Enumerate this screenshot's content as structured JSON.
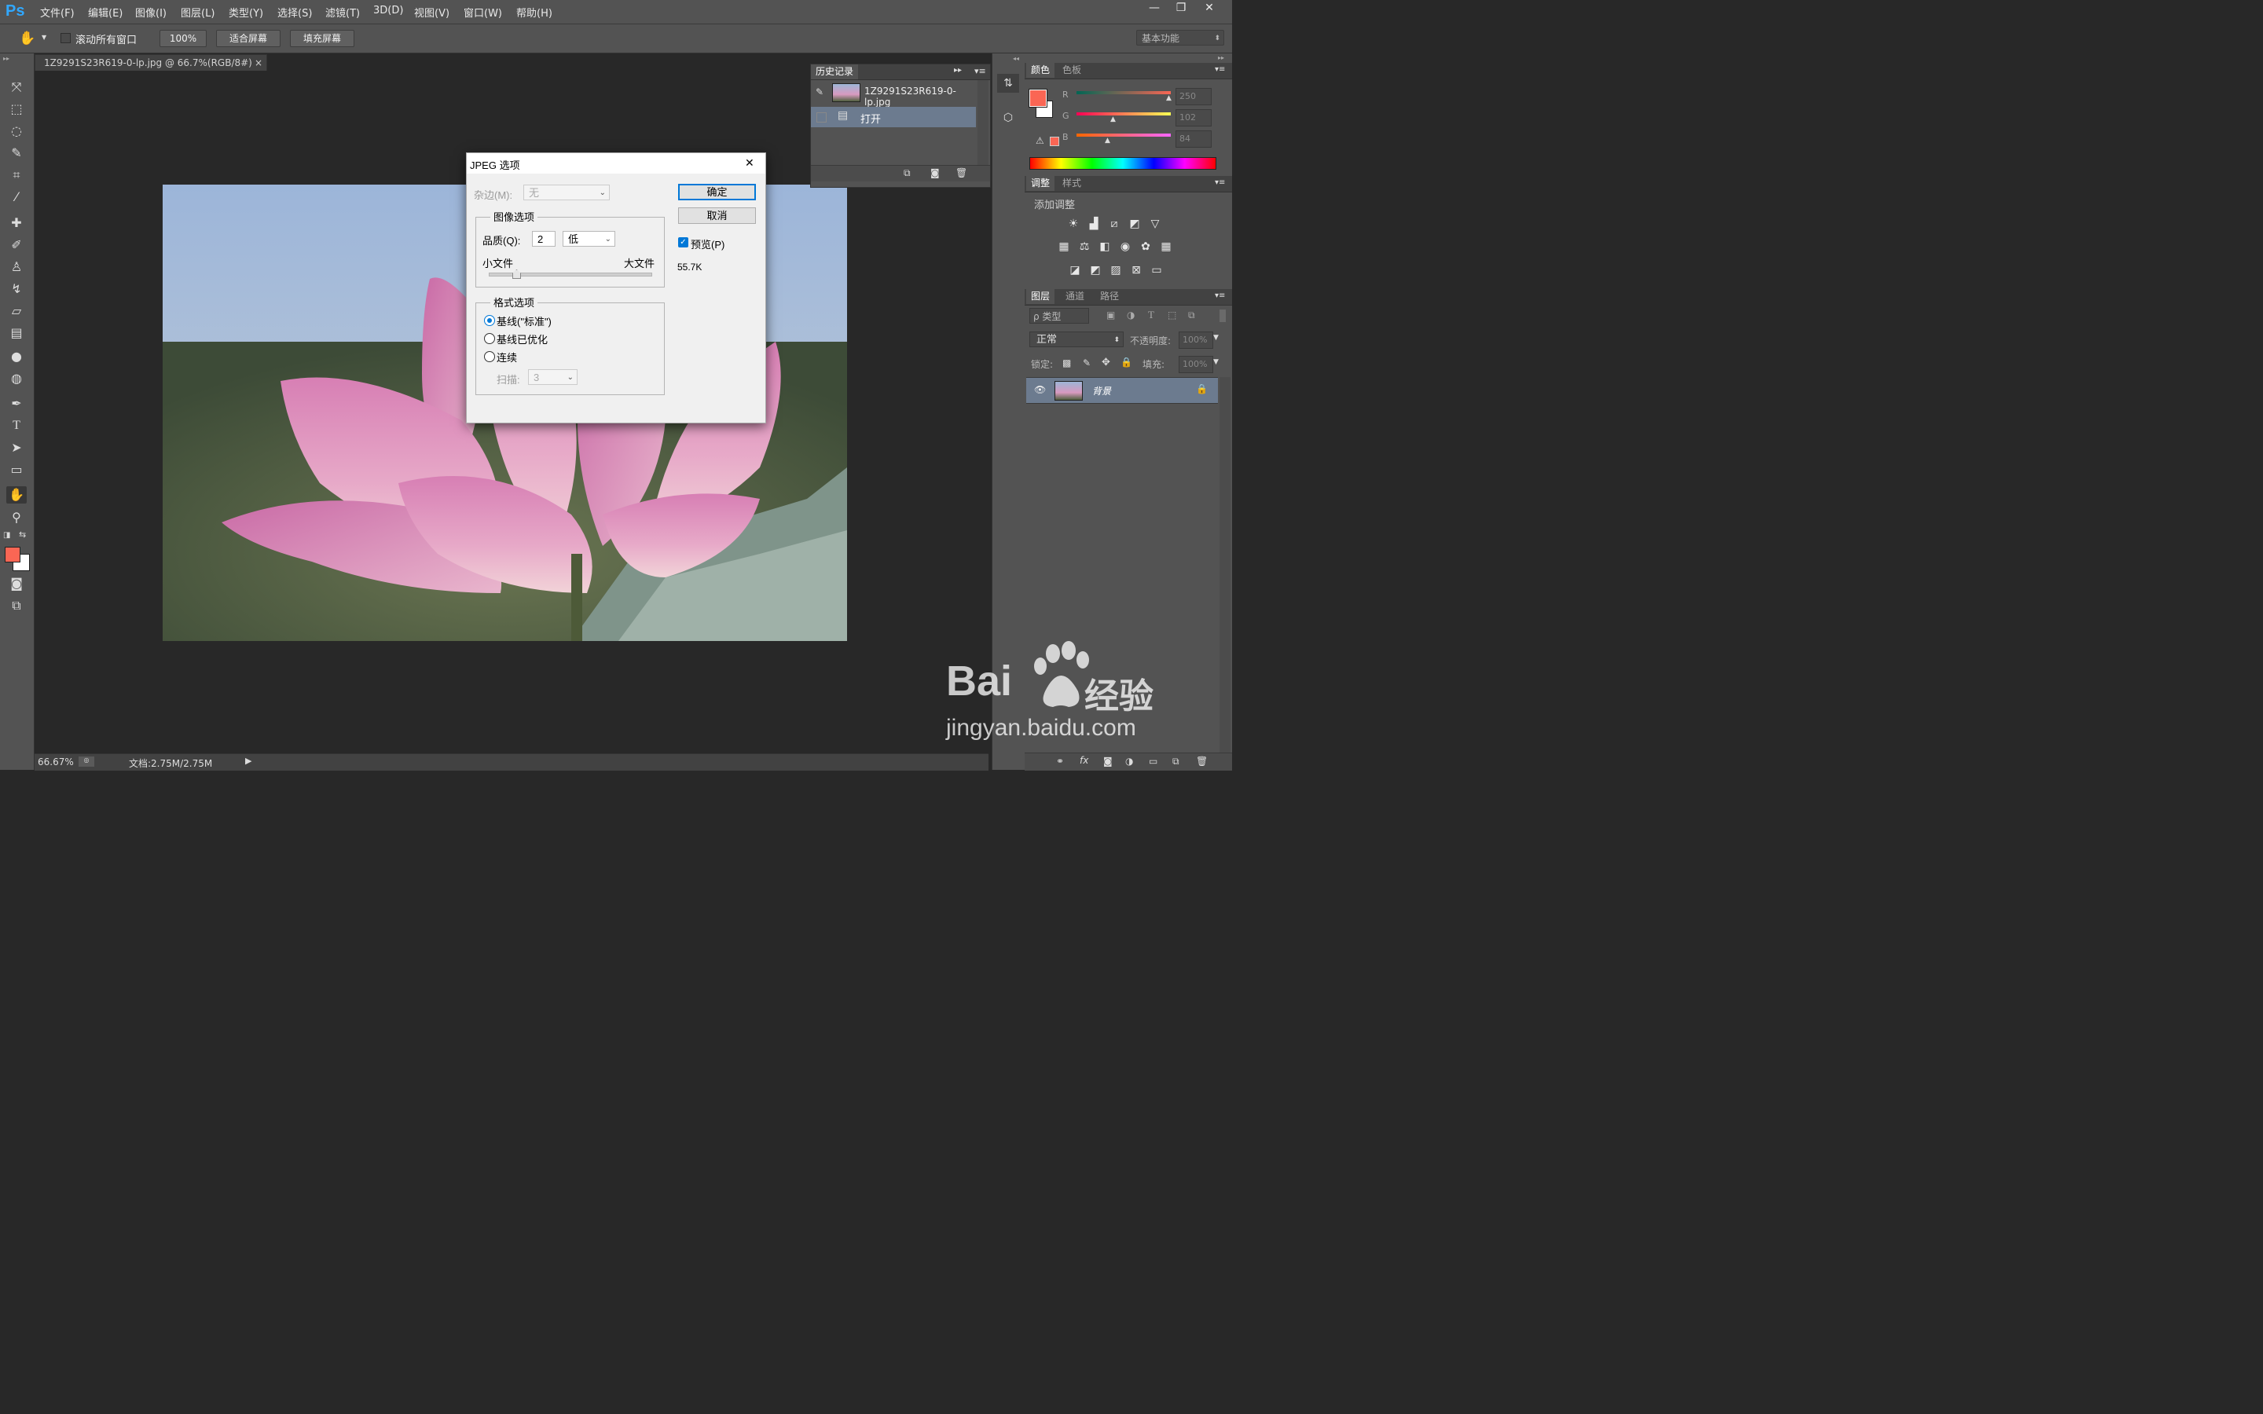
{
  "app": {
    "logo": "Ps"
  },
  "menu": [
    "文件(F)",
    "编辑(E)",
    "图像(I)",
    "图层(L)",
    "类型(Y)",
    "选择(S)",
    "滤镜(T)",
    "3D(D)",
    "视图(V)",
    "窗口(W)",
    "帮助(H)"
  ],
  "window_controls": [
    "—",
    "❐",
    "✕"
  ],
  "options": {
    "scroll_all_label": "滚动所有窗口",
    "zoom_btn": "100%",
    "fit_btn": "适合屏幕",
    "fill_btn": "填充屏幕",
    "workspace": "基本功能"
  },
  "document": {
    "tab_title": "1Z9291S23R619-0-lp.jpg @ 66.7%(RGB/8#)",
    "tab_close": "×"
  },
  "status": {
    "zoom": "66.67%",
    "doc_size": "文档:2.75M/2.75M"
  },
  "history": {
    "tab": "历史记录",
    "snapshot_name": "1Z9291S23R619-0-lp.jpg",
    "steps": [
      "打开"
    ]
  },
  "color_panel": {
    "tabs": [
      "颜色",
      "色板"
    ],
    "r_label": "R",
    "g_label": "G",
    "b_label": "B",
    "r": "250",
    "g": "102",
    "b": "84",
    "foreground": "#fa6654",
    "background": "#ffffff"
  },
  "adjust_panel": {
    "tabs": [
      "调整",
      "样式"
    ],
    "add_label": "添加调整"
  },
  "layers_panel": {
    "tabs": [
      "图层",
      "通道",
      "路径"
    ],
    "filter_kind": "ρ 类型",
    "blend_mode": "正常",
    "opacity_label": "不透明度:",
    "opacity": "100%",
    "lock_label": "锁定:",
    "fill_label": "填充:",
    "fill": "100%",
    "layers": [
      {
        "name": "背景",
        "visible": true,
        "locked": true
      }
    ]
  },
  "dialog": {
    "title": "JPEG 选项",
    "close": "✕",
    "matte_label": "杂边(M):",
    "matte_value": "无",
    "ok": "确定",
    "cancel": "取消",
    "preview_label": "预览(P)",
    "preview_checked": true,
    "file_size": "55.7K",
    "image_group": "图像选项",
    "quality_label": "品质(Q):",
    "quality_value": "2",
    "quality_preset": "低",
    "small_file": "小文件",
    "large_file": "大文件",
    "quality_fraction": 0.17,
    "format_group": "格式选项",
    "formats": [
      "基线(\"标准\")",
      "基线已优化",
      "连续"
    ],
    "selected_format": 0,
    "scans_label": "扫描:",
    "scans_value": "3"
  },
  "watermark": {
    "brand": "Bai",
    "brand2": "经验",
    "url": "jingyan.baidu.com"
  }
}
